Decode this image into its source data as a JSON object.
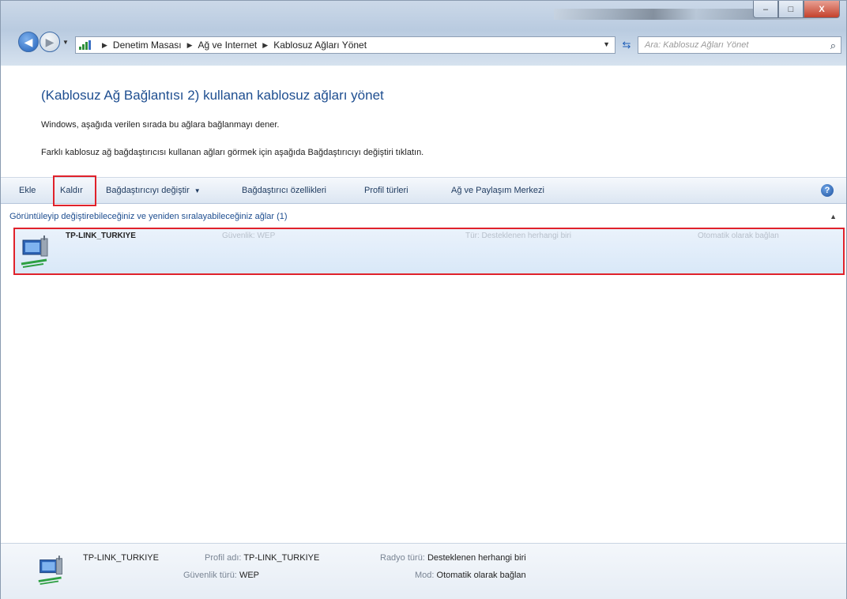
{
  "window": {
    "breadcrumb": [
      "Denetim Masası",
      "Ağ ve Internet",
      "Kablosuz Ağları Yönet"
    ],
    "search_placeholder": "Ara: Kablosuz Ağları Yönet",
    "buttons": {
      "minimize": "–",
      "maximize": "□",
      "close": "X"
    }
  },
  "page": {
    "heading": "(Kablosuz Ağ Bağlantısı 2) kullanan kablosuz ağları yönet",
    "line1": "Windows, aşağıda verilen sırada bu ağlara bağlanmayı dener.",
    "line2": "Farklı kablosuz ağ bağdaştırıcısı kullanan ağları görmek için aşağıda Bağdaştırıcıyı değiştiri tıklatın."
  },
  "toolbar": {
    "add": "Ekle",
    "remove": "Kaldır",
    "change_adapter": "Bağdaştırıcıyı değiştir",
    "adapter_props": "Bağdaştırıcı özellikleri",
    "profile_types": "Profil türleri",
    "network_center": "Ağ ve Paylaşım Merkezi"
  },
  "group": {
    "header": "Görüntüleyip değiştirebileceğiniz ve yeniden sıralayabileceğiniz ağlar (1)"
  },
  "network": {
    "name": "TP-LINK_TURKIYE",
    "security": "Güvenlik: WEP",
    "type": "Tür: Desteklenen herhangi biri",
    "mode": "Otomatik olarak bağlan"
  },
  "details": {
    "name": "TP-LINK_TURKIYE",
    "profile_label": "Profil adı:",
    "profile_value": "TP-LINK_TURKIYE",
    "security_label": "Güvenlik türü:",
    "security_value": "WEP",
    "radio_label": "Radyo türü:",
    "radio_value": "Desteklenen herhangi biri",
    "mode_label": "Mod:",
    "mode_value": "Otomatik olarak bağlan"
  },
  "colors": {
    "highlight": "#e0222b",
    "link": "#1e4e90"
  }
}
